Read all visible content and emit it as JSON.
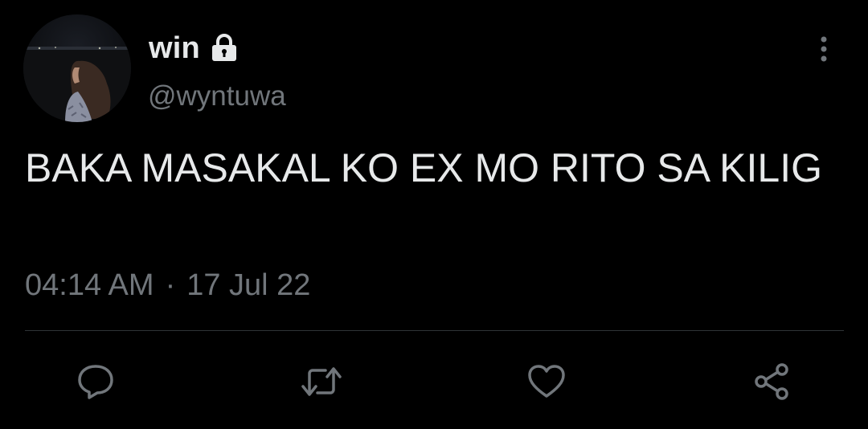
{
  "author": {
    "display_name": "win",
    "handle": "@wyntuwa",
    "protected_icon": "lock-icon",
    "avatar_icon": "avatar"
  },
  "tweet": {
    "text": "BAKA MASAKAL KO EX MO RITO SA KILIG",
    "time": "04:14 AM",
    "separator": "·",
    "date": "17 Jul 22"
  },
  "actions": [
    {
      "name": "reply",
      "icon": "comment-icon"
    },
    {
      "name": "retweet",
      "icon": "retweet-icon"
    },
    {
      "name": "like",
      "icon": "heart-icon"
    },
    {
      "name": "share",
      "icon": "share-icon"
    }
  ],
  "menu": {
    "icon": "more-vertical-icon"
  },
  "colors": {
    "background": "#000000",
    "primary_text": "#e7e9ea",
    "secondary_text": "#71767b",
    "divider": "#2f3336"
  }
}
